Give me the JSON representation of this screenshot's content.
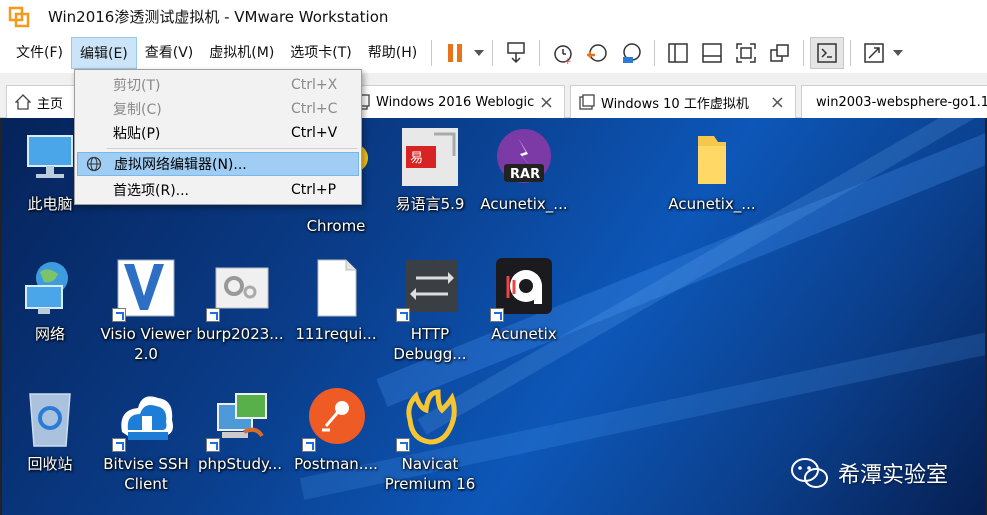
{
  "window": {
    "title": "Win2016渗透测试虚拟机 - VMware Workstation"
  },
  "menubar": {
    "items": [
      "文件(F)",
      "编辑(E)",
      "查看(V)",
      "虚拟机(M)",
      "选项卡(T)",
      "帮助(H)"
    ],
    "active_index": 1
  },
  "toolbar": {
    "icons": [
      "pause-icon",
      "dropdown-arrow-icon",
      "send-ctrl-alt-del-icon",
      "snapshot-icon",
      "revert-snapshot-icon",
      "snapshot-manager-icon",
      "sidebar-icon",
      "thumbnail-bar-icon",
      "full-screen-icon",
      "unity-icon",
      "console-icon",
      "stretch-icon",
      "dropdown-arrow-icon"
    ]
  },
  "tabs": [
    {
      "label": "主页"
    },
    {
      "label": "Windows 2016 Weblogic"
    },
    {
      "label": "Windows 10 工作虚拟机"
    },
    {
      "label": "win2003-websphere-go1.1"
    }
  ],
  "edit_menu": {
    "items": [
      {
        "label": "剪切(T)",
        "shortcut": "Ctrl+X",
        "enabled": false
      },
      {
        "label": "复制(C)",
        "shortcut": "Ctrl+C",
        "enabled": false
      },
      {
        "label": "粘贴(P)",
        "shortcut": "Ctrl+V",
        "enabled": true
      },
      {
        "label": "虚拟网络编辑器(N)...",
        "shortcut": "",
        "enabled": true,
        "highlighted": true,
        "icon": "network-globe-icon"
      },
      {
        "label": "首选项(R)...",
        "shortcut": "Ctrl+P",
        "enabled": true
      }
    ]
  },
  "desktop": {
    "icons": [
      {
        "label": "此电脑",
        "icon": "this-pc-icon"
      },
      {
        "label": "Chrome",
        "icon": "chrome-icon"
      },
      {
        "label": "易语言5.9",
        "icon": "eyuyan-icon"
      },
      {
        "label": "Acunetix_...",
        "icon": "winrar-archive-icon"
      },
      {
        "label": "Acunetix_...",
        "icon": "folder-icon"
      },
      {
        "label": "网络",
        "icon": "network-icon"
      },
      {
        "label": "Visio Viewer 2.0",
        "icon": "visio-icon"
      },
      {
        "label": "burp2023...",
        "icon": "burp-icon"
      },
      {
        "label": "111requi...",
        "icon": "text-file-icon"
      },
      {
        "label": "HTTP Debugg...",
        "icon": "http-debugger-icon"
      },
      {
        "label": "Acunetix",
        "icon": "acunetix-icon"
      },
      {
        "label": "回收站",
        "icon": "recycle-bin-icon"
      },
      {
        "label": "Bitvise SSH Client",
        "icon": "bitvise-icon"
      },
      {
        "label": "phpStudy...",
        "icon": "phpstudy-icon"
      },
      {
        "label": "Postman....",
        "icon": "postman-icon"
      },
      {
        "label": "Navicat Premium 16",
        "icon": "navicat-icon"
      }
    ]
  },
  "watermark": {
    "text": "希潭实验室",
    "icon": "wechat-icon"
  },
  "colors": {
    "menu_highlight": "#9fcdf3",
    "pause_orange": "#e8731a",
    "desktop_blue": "#0a3d8a"
  }
}
